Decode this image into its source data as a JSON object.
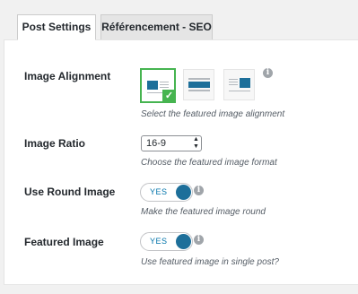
{
  "tabs": [
    {
      "label": "Post Settings",
      "active": true
    },
    {
      "label": "Référencement - SEO",
      "active": false
    }
  ],
  "fields": {
    "image_alignment": {
      "label": "Image Alignment",
      "description": "Select the featured image alignment",
      "options": [
        "left-align-icon",
        "full-width-icon",
        "right-align-icon"
      ],
      "selected_index": 0
    },
    "image_ratio": {
      "label": "Image Ratio",
      "value": "16-9",
      "description": "Choose the featured image format"
    },
    "round_image": {
      "label": "Use Round Image",
      "toggle_text": "YES",
      "description": "Make the featured image round"
    },
    "featured_image": {
      "label": "Featured Image",
      "toggle_text": "YES",
      "description": "Use featured image in single post?"
    }
  },
  "colors": {
    "accent": "#1d6f9a",
    "selected_border": "#46b450",
    "link_text": "#0073aa"
  }
}
